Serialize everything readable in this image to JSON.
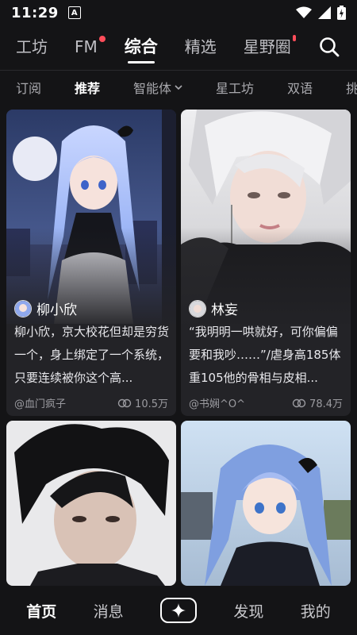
{
  "status": {
    "time": "11:29",
    "notif": "A"
  },
  "top_tabs": [
    {
      "label": "工坊"
    },
    {
      "label": "FM"
    },
    {
      "label": "综合"
    },
    {
      "label": "精选"
    },
    {
      "label": "星野圈"
    }
  ],
  "sub_tabs": [
    {
      "label": "订阅"
    },
    {
      "label": "推荐"
    },
    {
      "label": "智能体"
    },
    {
      "label": "星工坊"
    },
    {
      "label": "双语"
    },
    {
      "label": "挑"
    }
  ],
  "cards": [
    {
      "name": "柳小欣",
      "desc": "柳小欣，京大校花但却是穷货一个，身上绑定了一个系统，只要连续被你这个高...",
      "author": "@血门疯子",
      "views": "10.5万"
    },
    {
      "name": "林妄",
      "desc": "“我明明一哄就好，可你偏偏要和我吵……”/虐身高185体重105他的骨相与皮相...",
      "author": "@书娴^O^",
      "views": "78.4万"
    },
    {
      "name": "",
      "desc": "",
      "author": "",
      "views": ""
    },
    {
      "name": "",
      "desc": "",
      "author": "",
      "views": ""
    }
  ],
  "bottom_nav": [
    {
      "label": "首页"
    },
    {
      "label": "消息"
    },
    {
      "label": ""
    },
    {
      "label": "发现"
    },
    {
      "label": "我的"
    }
  ],
  "colors": {
    "background": "#141416",
    "card": "#232327",
    "badge": "#ff4d5a"
  }
}
